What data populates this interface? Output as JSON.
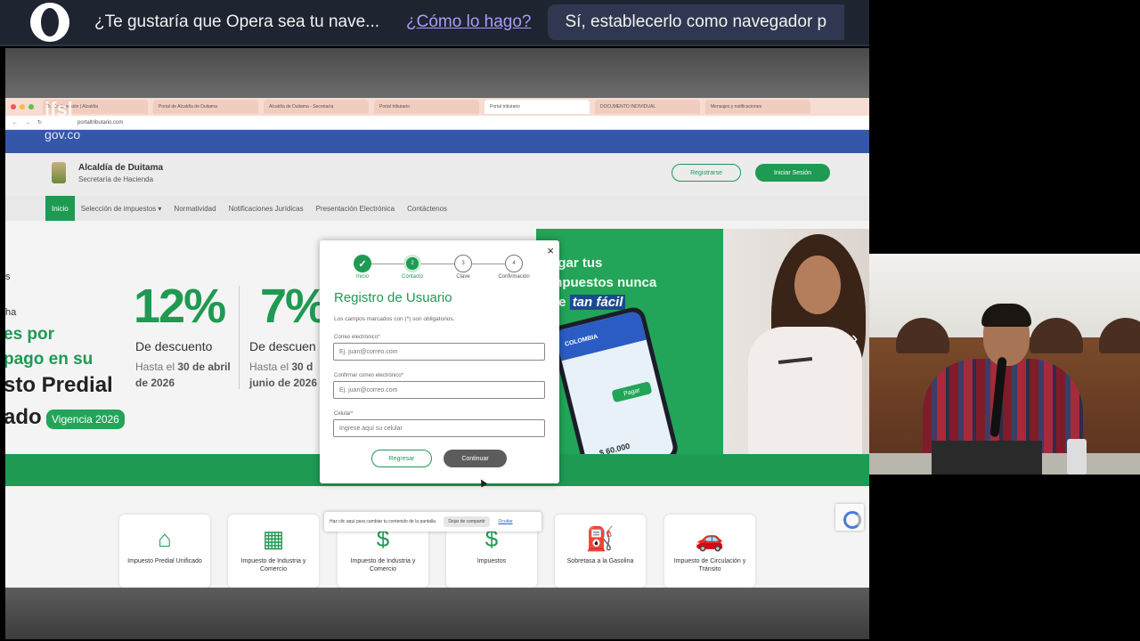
{
  "opera_bar": {
    "question": "¿Te gustaría que Opera sea tu nave...",
    "how_link": "¿Cómo lo hago?",
    "set_default_button": "Sí, establecerlo como navegador p"
  },
  "browser": {
    "tabs": [
      {
        "label": "Inicio de sesión | Alcaldía",
        "active": false
      },
      {
        "label": "Portal de Alcaldía de Duitama",
        "active": false
      },
      {
        "label": "Alcaldía de Duitama - Secretaría",
        "active": false
      },
      {
        "label": "Portal tributario",
        "active": false
      },
      {
        "label": "Portal tributario",
        "active": true
      },
      {
        "label": "DOCUMENTO INDIVIDUAL",
        "active": false
      },
      {
        "label": "Mensajes y notificaciones",
        "active": false
      }
    ],
    "url": "portaltributario.com"
  },
  "site": {
    "gov_domain": "gov.co",
    "watermark": "jfsl",
    "name": "Alcaldía de Duitama",
    "subtitle": "Secretaría de Hacienda",
    "register_button": "Registrarse",
    "login_button": "Iniciar Sesión",
    "nav": [
      {
        "label": "Inicio",
        "active": true
      },
      {
        "label": "Selección de impuestos ▾",
        "active": false
      },
      {
        "label": "Normatividad",
        "active": false
      },
      {
        "label": "Notificaciones Jurídicas",
        "active": false
      },
      {
        "label": "Presentación Electrónica",
        "active": false
      },
      {
        "label": "Contáctenos",
        "active": false
      }
    ]
  },
  "hero": {
    "left_text_1": "s",
    "left_text_2": "ha",
    "por": "es por",
    "pago": "pago en su",
    "predial": "sto Predial",
    "ado": "ado",
    "vigencia": "Vigencia 2026",
    "promo1": {
      "pct": "12%",
      "desc": "De descuento",
      "until": "Hasta el ",
      "date": "30 de abril de 2026"
    },
    "promo2": {
      "pct": "7%",
      "desc": "De descuen",
      "until": "Hasta el ",
      "date": "30 d junio de 2026"
    },
    "slogan_1": "agar tus",
    "slogan_2": "mpuestos nunca",
    "slogan_3": "ue",
    "slogan_highlight": "tan fácil",
    "phone_title": "COLOMBIA",
    "phone_pay": "Pagar",
    "phone_amount": "$ 60.000"
  },
  "modal": {
    "close": "×",
    "steps": [
      {
        "label": "Inicio",
        "state": "done",
        "mark": "✓"
      },
      {
        "label": "Contacto",
        "state": "current",
        "mark": "2"
      },
      {
        "label": "Clave",
        "state": "todo",
        "mark": "3"
      },
      {
        "label": "Confirmación",
        "state": "todo",
        "mark": "4"
      }
    ],
    "title": "Registro de Usuario",
    "required_note": "Los campos marcados con (*) son obligatorios.",
    "fields": [
      {
        "label": "Correo electrónico*",
        "placeholder": "Ej. juan@correo.com"
      },
      {
        "label": "Confirmar correo electrónico*",
        "placeholder": "Ej. juan@correo.com"
      },
      {
        "label": "Celular*",
        "placeholder": "Ingrese aquí su celular"
      }
    ],
    "back_button": "Regresar",
    "continue_button": "Continuar"
  },
  "services": [
    {
      "icon": "house-icon",
      "glyph": "⌂",
      "label": "Impuesto Predial Unificado"
    },
    {
      "icon": "factory-icon",
      "glyph": "▦",
      "label": "Impuesto de Industria y Comercio"
    },
    {
      "icon": "money-icon",
      "glyph": "$",
      "label": "Impuesto de Industria y Comercio"
    },
    {
      "icon": "bag-icon",
      "glyph": "$",
      "label": "Impuestos"
    },
    {
      "icon": "fuel-pump-icon",
      "glyph": "⛽",
      "label": "Sobretasa a la Gasolina"
    },
    {
      "icon": "car-icon",
      "glyph": "🚗",
      "label": "Impuesto de Circulación y Tránsito"
    }
  ],
  "cookie_banner": {
    "text": "Haz clic aquí para cambiar tu contenido de la pantalla.",
    "button": "Dejar de compartir",
    "link": "Ocultar"
  }
}
